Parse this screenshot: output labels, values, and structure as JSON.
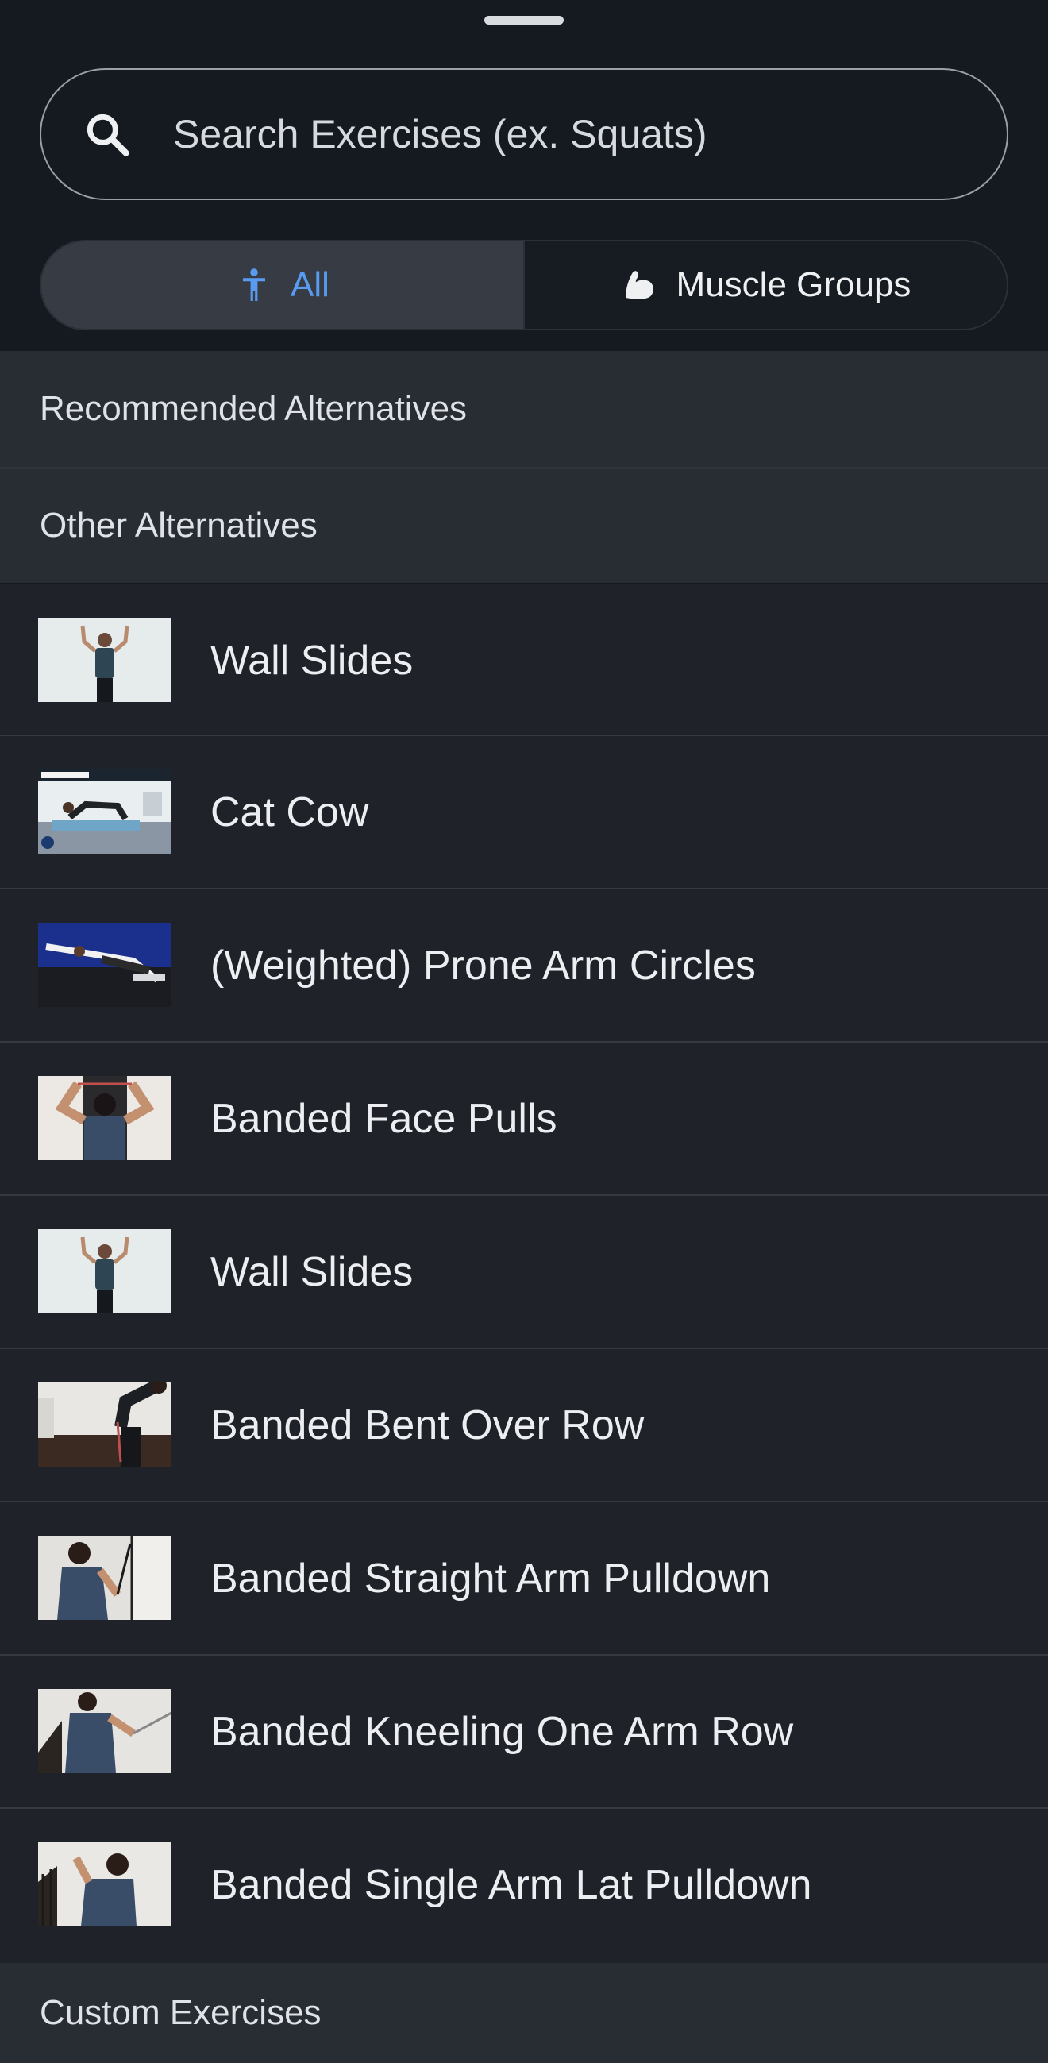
{
  "search": {
    "placeholder": "Search Exercises (ex. Squats)",
    "icon": "search-icon"
  },
  "tabs": [
    {
      "label": "All",
      "icon": "person-icon",
      "active": true
    },
    {
      "label": "Muscle Groups",
      "icon": "flexed-arm-icon",
      "active": false
    }
  ],
  "sections": {
    "recommended": "Recommended Alternatives",
    "other": "Other Alternatives",
    "custom": "Custom Exercises"
  },
  "exercises": [
    {
      "name": "Wall Slides"
    },
    {
      "name": "Cat Cow"
    },
    {
      "name": "(Weighted) Prone Arm Circles"
    },
    {
      "name": "Banded Face Pulls"
    },
    {
      "name": "Wall Slides"
    },
    {
      "name": "Banded Bent Over Row"
    },
    {
      "name": "Banded Straight Arm Pulldown"
    },
    {
      "name": "Banded Kneeling One Arm Row"
    },
    {
      "name": "Banded Single Arm Lat Pulldown"
    }
  ],
  "colors": {
    "accent": "#5a9bf2",
    "background": "#1f2329",
    "header": "#151a21",
    "section": "#282d34"
  }
}
